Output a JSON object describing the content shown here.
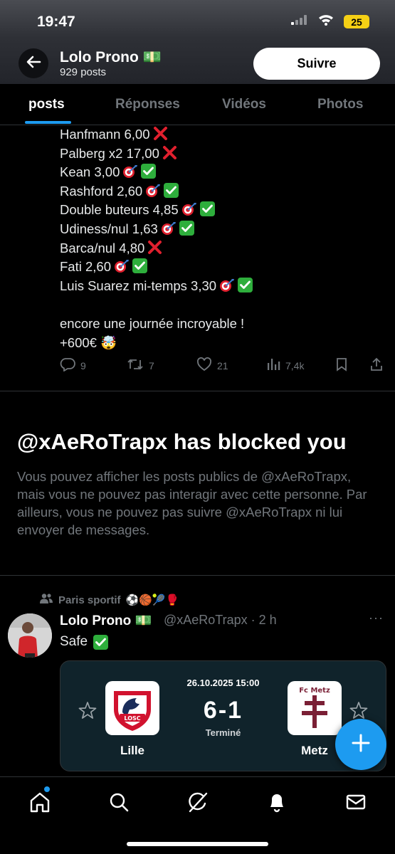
{
  "status_bar": {
    "time": "19:47",
    "battery": "25"
  },
  "header": {
    "name": "Lolo Prono",
    "name_emoji": "💵",
    "posts_count": "929 posts",
    "follow_label": "Suivre"
  },
  "tabs": [
    {
      "label": "posts"
    },
    {
      "label": "Réponses"
    },
    {
      "label": "Vidéos"
    },
    {
      "label": "Photos"
    }
  ],
  "tweet1": {
    "lines": [
      {
        "text": "Hanfmann 6,00",
        "marks": [
          "cross"
        ]
      },
      {
        "text": "Palberg x2 17,00",
        "marks": [
          "cross"
        ]
      },
      {
        "text": "Kean 3,00",
        "marks": [
          "dart",
          "check"
        ]
      },
      {
        "text": "Rashford 2,60",
        "marks": [
          "dart",
          "check"
        ]
      },
      {
        "text": "Double buteurs 4,85",
        "marks": [
          "dart",
          "check"
        ]
      },
      {
        "text": "Udiness/nul 1,63",
        "marks": [
          "dart",
          "check"
        ]
      },
      {
        "text": "Barca/nul 4,80",
        "marks": [
          "cross"
        ]
      },
      {
        "text": "Fati 2,60",
        "marks": [
          "dart",
          "check"
        ]
      },
      {
        "text": "Luis Suarez mi-temps 3,30",
        "marks": [
          "dart",
          "check"
        ]
      }
    ],
    "closing_line": "encore une journée incroyable !",
    "profit": "+600€",
    "profit_emoji": "🤯",
    "actions": {
      "replies": "9",
      "reposts": "7",
      "likes": "21",
      "views": "7,4k"
    }
  },
  "blocked": {
    "title": "@xAeRoTrapx has blocked you",
    "text": "Vous pouvez afficher les posts publics de @xAeRoTrapx, mais vous ne pouvez pas interagir avec cette personne. Par ailleurs, vous ne pouvez pas suivre @xAeRoTrapx ni lui envoyer de messages."
  },
  "tweet2": {
    "context": "Paris sportif",
    "context_emojis": "⚽🏀🎾🥊",
    "name": "Lolo Prono",
    "name_emoji": "💵",
    "handle_time": "@xAeRoTrapx · 2 h",
    "text": "Safe",
    "more": "···"
  },
  "match": {
    "datetime": "26.10.2025 15:00",
    "score": "6-1",
    "status": "Terminé",
    "home": {
      "name": "Lille",
      "badge": "LOSC"
    },
    "away": {
      "name": "Metz",
      "badge": "Fc Metz"
    }
  },
  "nav": {
    "items": [
      "home",
      "search",
      "grok",
      "notifications",
      "messages"
    ]
  },
  "colors": {
    "accent": "#1d9bf0",
    "bg": "#000000",
    "muted": "#71767b",
    "card": "#10232b"
  }
}
